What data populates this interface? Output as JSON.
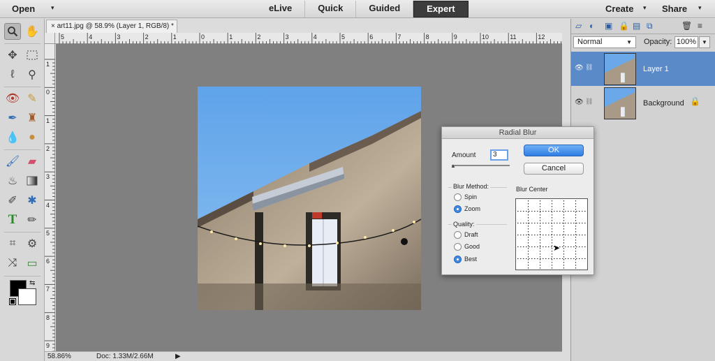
{
  "topbar": {
    "open_label": "Open",
    "modes": [
      "eLive",
      "Quick",
      "Guided",
      "Expert"
    ],
    "active_mode": "Expert",
    "create_label": "Create",
    "share_label": "Share"
  },
  "document": {
    "tab_title": "art11.jpg @ 58.9% (Layer 1, RGB/8) *",
    "ruler_h": [
      "5",
      "4",
      "3",
      "2",
      "1",
      "0",
      "1",
      "2",
      "3",
      "4",
      "5",
      "6",
      "7",
      "8",
      "9",
      "10",
      "11",
      "12"
    ],
    "ruler_v": [
      "1",
      "0",
      "1",
      "2",
      "3",
      "4",
      "5",
      "6",
      "7",
      "8",
      "9"
    ]
  },
  "status": {
    "zoom": "58.86%",
    "doc": "Doc: 1.33M/2.66M"
  },
  "layers_panel": {
    "blend_mode": "Normal",
    "opacity_label": "Opacity:",
    "opacity_value": "100%",
    "layers": [
      {
        "name": "Layer 1",
        "active": true
      },
      {
        "name": "Background",
        "active": false
      }
    ]
  },
  "dialog": {
    "title": "Radial Blur",
    "amount_label": "Amount",
    "amount_value": "3",
    "ok_label": "OK",
    "cancel_label": "Cancel",
    "blur_method_label": "Blur Method:",
    "methods": [
      "Spin",
      "Zoom"
    ],
    "selected_method": "Zoom",
    "quality_label": "Quality:",
    "qualities": [
      "Draft",
      "Good",
      "Best"
    ],
    "selected_quality": "Best",
    "blur_center_label": "Blur Center"
  },
  "colors": {
    "accent": "#5b8ac8",
    "ok_button": "#2f7ee4",
    "canvas_bg": "#808080"
  }
}
